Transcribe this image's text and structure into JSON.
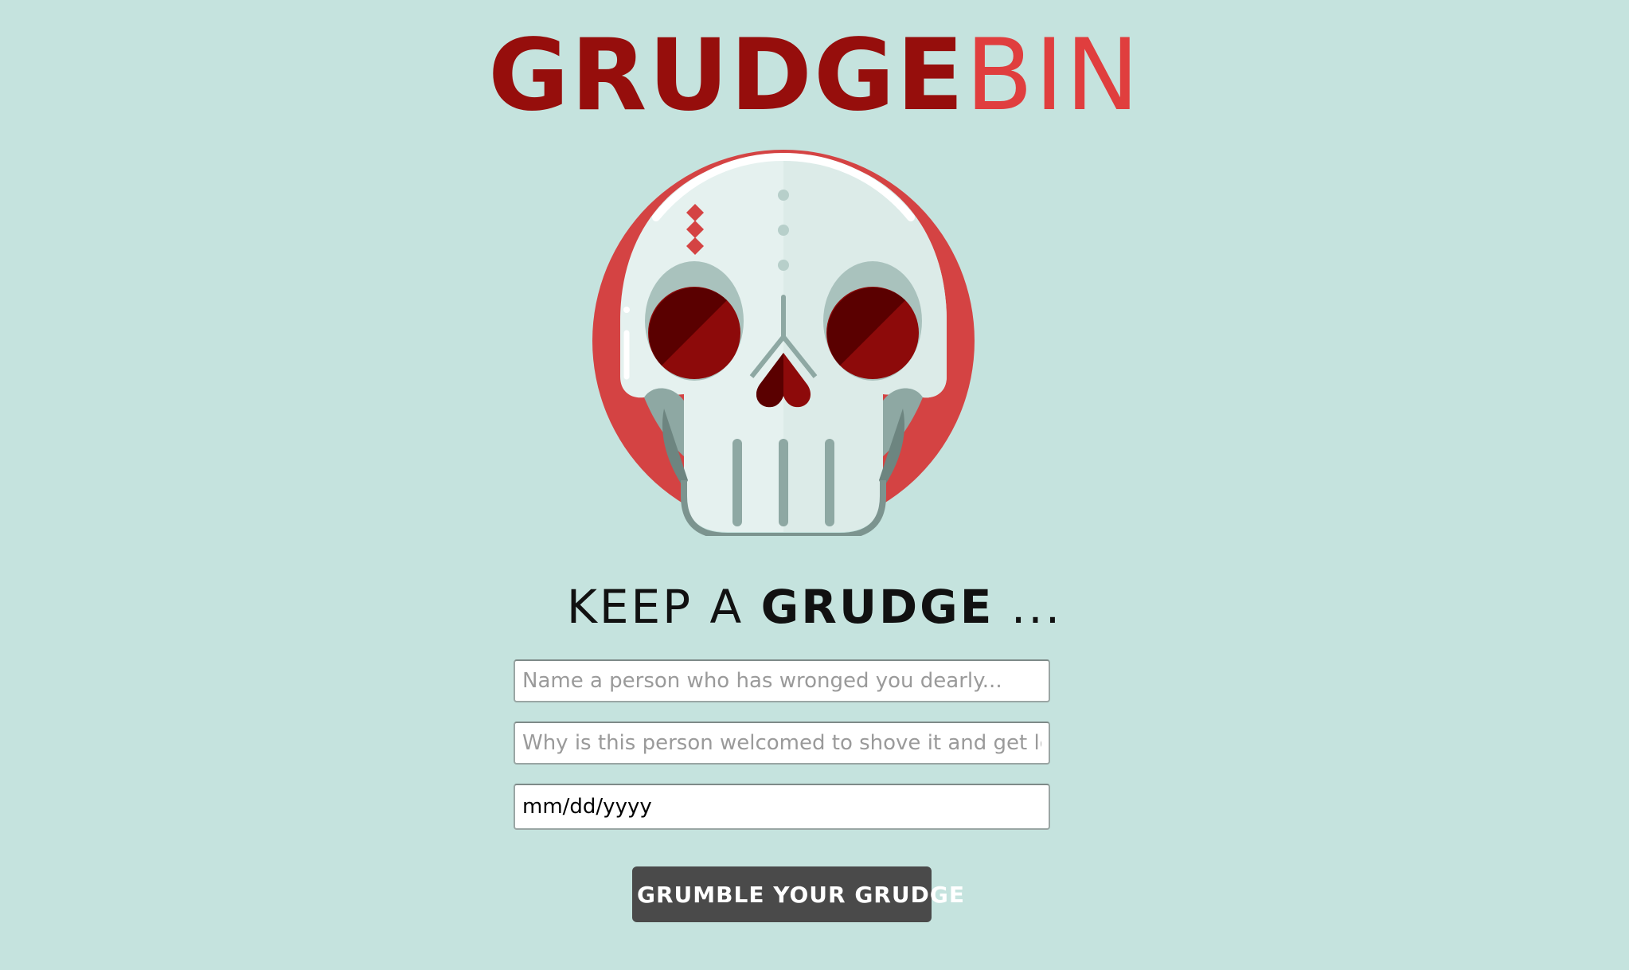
{
  "header": {
    "logo_part_1": "GRUDGE",
    "logo_part_2": "BIN",
    "logo_color_1": "#960e0c",
    "logo_color_2": "#e03e3e"
  },
  "illustration": {
    "icon": "skull-icon",
    "colors": {
      "ring": "#d44343",
      "bone": "#e5f1ef",
      "bone_shadow": "#b7cfca",
      "eye": "#8d0a0a",
      "eye_shade": "#5a0000",
      "jaw_shadow": "#7c948f"
    }
  },
  "form": {
    "heading_prefix": "KEEP A ",
    "heading_emphasis": "GRUDGE",
    "heading_suffix": " ...",
    "name_placeholder": "Name a person who has wronged you dearly...",
    "reason_placeholder": "Why is this person welcomed to shove it and get lost?",
    "date_value": "mm/dd/yyyy",
    "submit_label": "GRUMBLE YOUR GRUDGE"
  },
  "theme": {
    "background": "#c5e3de",
    "button_bg": "#4a4a4a"
  }
}
